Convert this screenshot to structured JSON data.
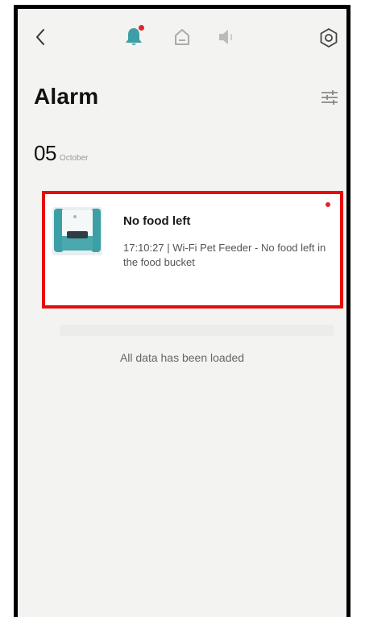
{
  "header": {
    "icons": [
      "back-icon",
      "bell-icon",
      "home-icon",
      "speaker-icon",
      "settings-icon"
    ],
    "active_tab": "alarm",
    "notification_dot_color": "#e1262f"
  },
  "page": {
    "title": "Alarm"
  },
  "date_group": {
    "day": "05",
    "month": "October"
  },
  "alarms": [
    {
      "title": "No food left",
      "time": "17:10:27",
      "device": "Wi-Fi Pet Feeder",
      "message": "No food left in the food bucket",
      "detail": "17:10:27 | Wi-Fi Pet Feeder - No food left in the food bucket",
      "unread": true
    }
  ],
  "footer": {
    "loaded_text": "All data has been loaded"
  },
  "colors": {
    "accent": "#3d9fa6",
    "highlight_border": "#e80a0a",
    "background": "#f3f3f1"
  }
}
